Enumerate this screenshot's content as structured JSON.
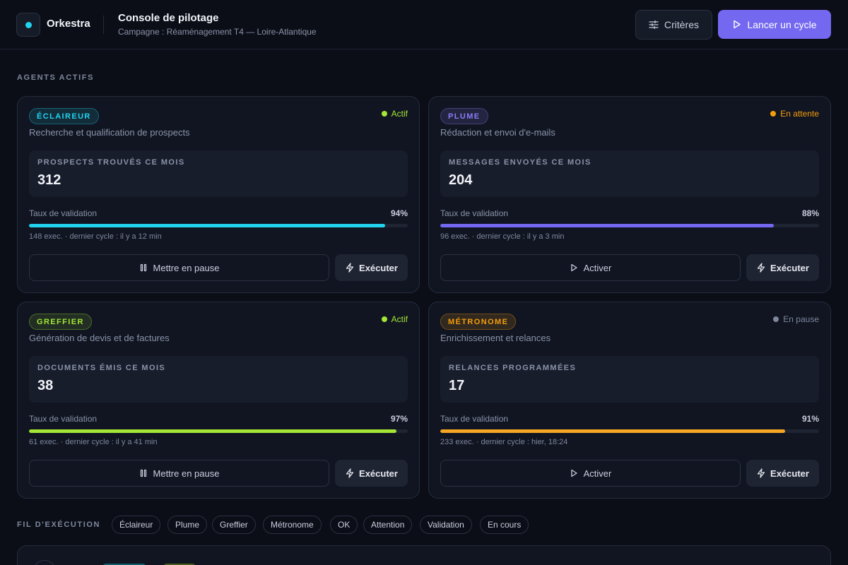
{
  "header": {
    "brand": "Orkestra",
    "title": "Console de pilotage",
    "subtitle": "Campagne : Réaménagement T4 — Loire-Atlantique",
    "criteria_button": "Critères",
    "run_button": "Lancer un cycle"
  },
  "agents_section": {
    "label": "AGENTS ACTIFS"
  },
  "agents": [
    {
      "tag": "ÉCLAIREUR",
      "tag_color": "#22d3ee",
      "status": "Actif",
      "status_color": "#a3e635",
      "description": "Recherche et qualification de prospects",
      "metric_label": "PROSPECTS TROUVÉS CE MOIS",
      "metric_value": "312",
      "rate_label": "Taux de validation",
      "rate": "94%",
      "rate_fraction": 0.94,
      "bar_color": "#22d3ee",
      "meta": "148 exec. · dernier cycle : il y a 12 min",
      "primary_action": "Mettre en pause",
      "primary_icon": "pause-icon",
      "exec_action": "Exécuter"
    },
    {
      "tag": "PLUME",
      "tag_color": "#8b7cf6",
      "status": "En attente",
      "status_color": "#f59e0b",
      "description": "Rédaction et envoi d'e-mails",
      "metric_label": "MESSAGES ENVOYÉS CE MOIS",
      "metric_value": "204",
      "rate_label": "Taux de validation",
      "rate": "88%",
      "rate_fraction": 0.88,
      "bar_color": "#7468f0",
      "meta": "96 exec. · dernier cycle : il y a 3 min",
      "primary_action": "Activer",
      "primary_icon": "play-icon",
      "exec_action": "Exécuter"
    },
    {
      "tag": "GREFFIER",
      "tag_color": "#a3e635",
      "status": "Actif",
      "status_color": "#a3e635",
      "description": "Génération de devis et de factures",
      "metric_label": "DOCUMENTS ÉMIS CE MOIS",
      "metric_value": "38",
      "rate_label": "Taux de validation",
      "rate": "97%",
      "rate_fraction": 0.97,
      "bar_color": "#a3e635",
      "meta": "61 exec. · dernier cycle : il y a 41 min",
      "primary_action": "Mettre en pause",
      "primary_icon": "pause-icon",
      "exec_action": "Exécuter"
    },
    {
      "tag": "MÉTRONOME",
      "tag_color": "#f59e0b",
      "status": "En pause",
      "status_color": "#7e879c",
      "description": "Enrichissement et relances",
      "metric_label": "RELANCES PROGRAMMÉES",
      "metric_value": "17",
      "rate_label": "Taux de validation",
      "rate": "91%",
      "rate_fraction": 0.91,
      "bar_color": "#f5a623",
      "meta": "233 exec. · dernier cycle : hier, 18:24",
      "primary_action": "Activer",
      "primary_icon": "play-icon",
      "exec_action": "Exécuter"
    }
  ],
  "feed": {
    "label": "FIL D'EXÉCUTION",
    "filters": [
      "Éclaireur",
      "Plume",
      "Greffier",
      "Métronome",
      "OK",
      "Attention",
      "Validation",
      "En cours"
    ]
  }
}
